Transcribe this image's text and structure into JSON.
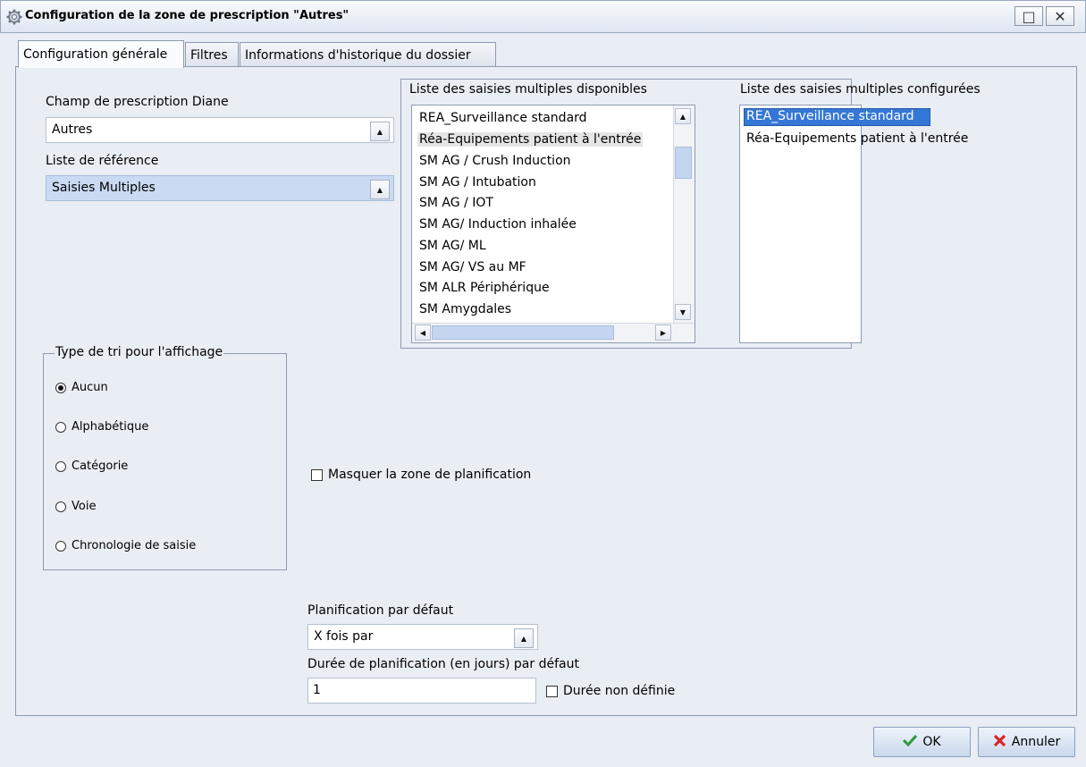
{
  "window": {
    "title": "Configuration de la zone de prescription \"Autres\"",
    "maximize_glyph": "□",
    "close_glyph": "✕"
  },
  "tabs": [
    {
      "label": "Configuration générale",
      "active": true
    },
    {
      "label": "Filtres",
      "active": false
    },
    {
      "label": "Informations d'historique du dossier",
      "active": false
    }
  ],
  "champ": {
    "label": "Champ de prescription Diane",
    "value": "Autres"
  },
  "liste_reference": {
    "label": "Liste de référence",
    "value": "Saisies Multiples"
  },
  "disponibles": {
    "title": "Liste des saisies multiples disponibles",
    "items": [
      "REA_Surveillance standard",
      "Réa-Equipements patient à l'entrée",
      "SM AG / Crush Induction",
      "SM AG / Intubation",
      "SM AG / IOT",
      "SM AG/ Induction inhalée",
      "SM AG/ ML",
      "SM AG/ VS au MF",
      "SM ALR Périphérique",
      "SM Amygdales"
    ]
  },
  "configurees": {
    "title": "Liste des saisies multiples configurées",
    "items": [
      "REA_Surveillance standard",
      "Réa-Equipements patient à l'entrée"
    ],
    "selected_index": 0
  },
  "tri": {
    "legend": "Type de tri pour l'affichage",
    "options": [
      "Aucun",
      "Alphabétique",
      "Catégorie",
      "Voie",
      "Chronologie de saisie"
    ],
    "selected": "Aucun"
  },
  "masquer": {
    "label": "Masquer la zone de planification",
    "checked": false
  },
  "planification": {
    "label": "Planification par défaut",
    "value": "X fois par"
  },
  "duree": {
    "label": "Durée de planification (en jours) par défaut",
    "value": "1",
    "non_definie_label": "Durée non définie",
    "non_definie_checked": false
  },
  "buttons": {
    "ok": "OK",
    "annuler": "Annuler"
  },
  "colors": {
    "selection": "#3477d6",
    "ok_check": "#2e9a3a",
    "annuler_x": "#d8262a"
  }
}
